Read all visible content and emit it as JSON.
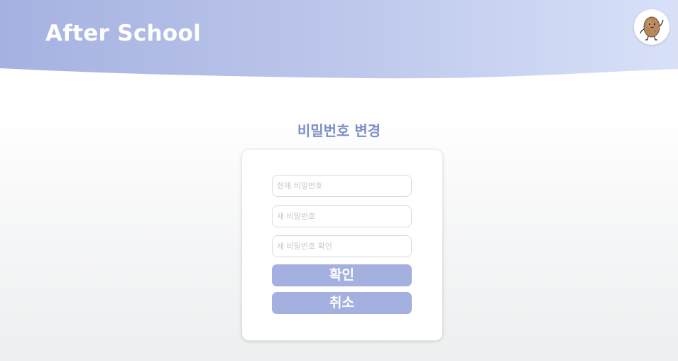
{
  "header": {
    "brand": "After School",
    "colors": {
      "gradient_start": "#a5b1e1",
      "gradient_end": "#d8e1f8"
    }
  },
  "avatar": {
    "icon": "potato-mascot-icon"
  },
  "page": {
    "title": "비밀번호 변경"
  },
  "form": {
    "current_password": {
      "placeholder": "현재 비밀번호",
      "value": ""
    },
    "new_password": {
      "placeholder": "새 비밀번호",
      "value": ""
    },
    "confirm_password": {
      "placeholder": "새 비밀번호 확인",
      "value": ""
    },
    "confirm_label": "확인",
    "cancel_label": "취소"
  },
  "colors": {
    "title": "#7d8fc9",
    "button": "#a4b0e0"
  }
}
